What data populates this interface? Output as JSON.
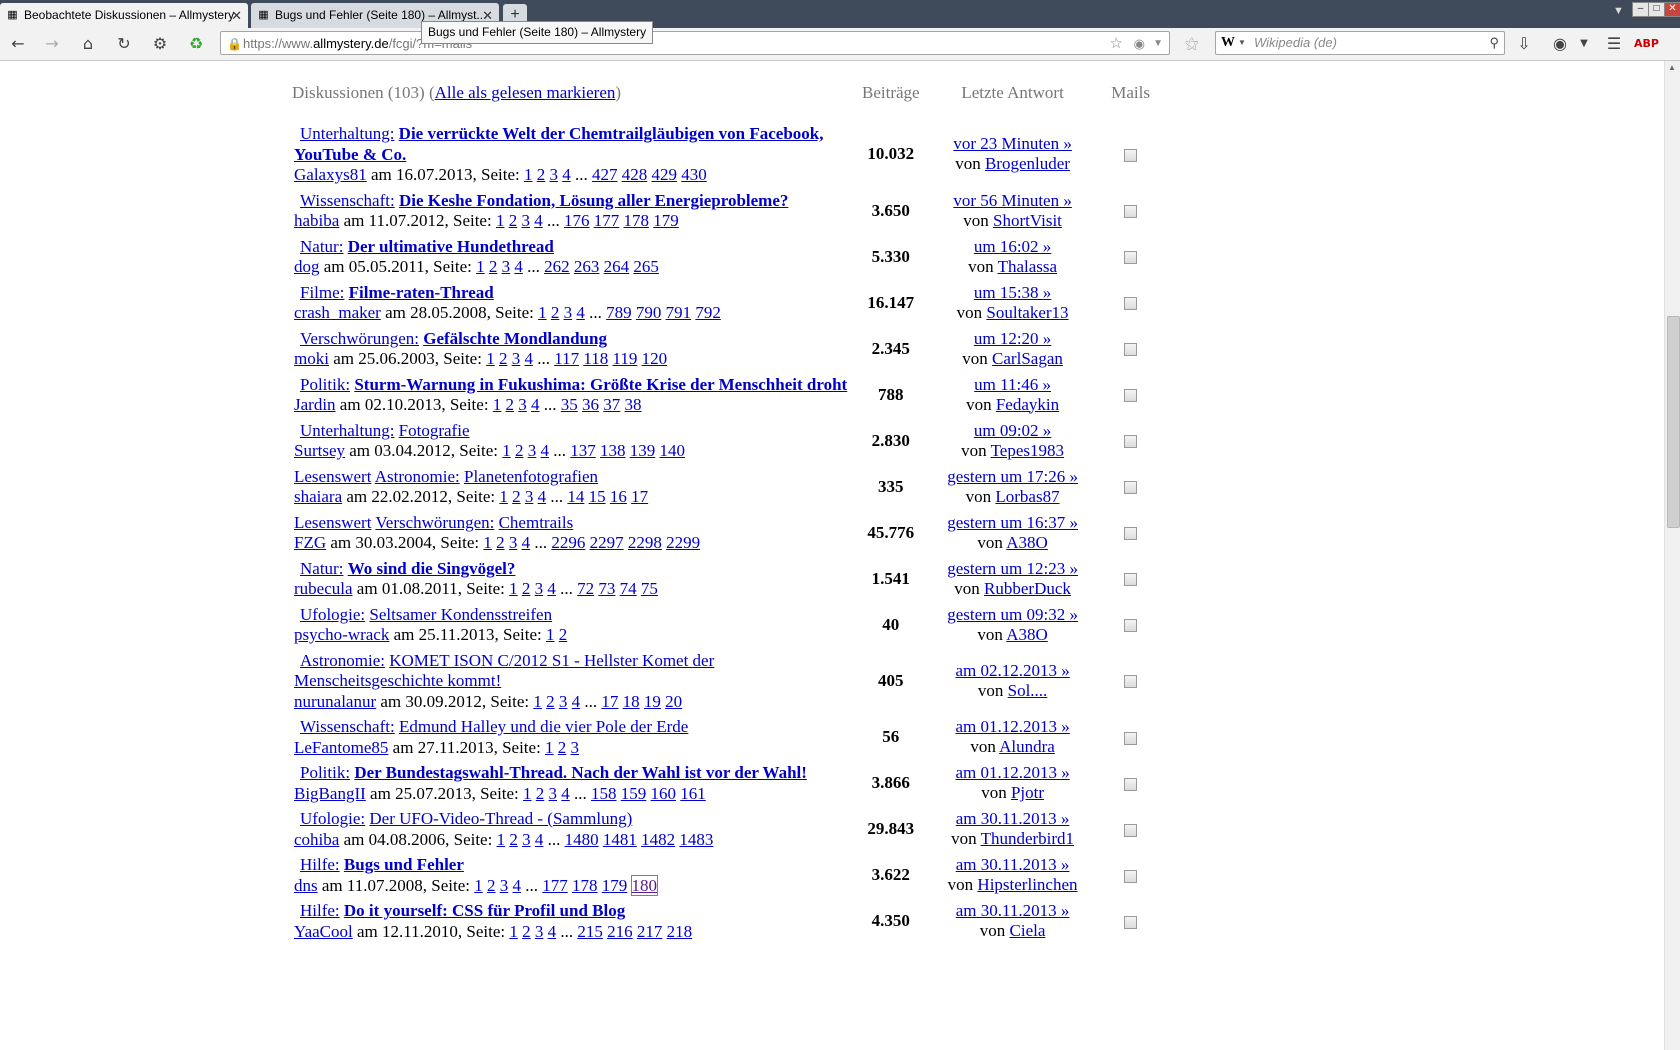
{
  "browser": {
    "tabs": [
      {
        "title": "Beobachtete Diskussionen – Allmystery",
        "active": true
      },
      {
        "title": "Bugs und Fehler (Seite 180) – Allmyst...",
        "active": false
      }
    ],
    "tooltip": "Bugs und Fehler (Seite 180) – Allmystery",
    "url_prefix": "https://www.",
    "url_domain": "allmystery.de",
    "url_path": "/fcgi/?m=mails",
    "search_placeholder": "Wikipedia (de)",
    "search_engine_label": "W",
    "icons": {
      "back": "arrow-left",
      "forward": "arrow-right",
      "home": "house",
      "reload": "circular-arrow",
      "addon1": "gears",
      "addon2": "green-refresh",
      "lock": "padlock",
      "bookmark": "star",
      "pocket": "pocket",
      "rss": "rss",
      "download": "arrow-down",
      "pocket_toolbar": "pocket",
      "menu": "hamburger",
      "adblock": "abp"
    }
  },
  "header": {
    "prefix": "Diskussionen (103) (",
    "mark_all": "Alle als gelesen markieren",
    "suffix": ")",
    "col_posts": "Beiträge",
    "col_last": "Letzte Antwort",
    "col_mails": "Mails"
  },
  "labels": {
    "on": "am",
    "pages": "Seite:",
    "by": "von",
    "ellipsis": "...",
    "lesenswert": "Lesenswert"
  },
  "threads": [
    {
      "lesenswert": false,
      "category": "Unterhaltung:",
      "title": "Die verrückte Welt der Chemtrailgläubigen von Facebook, YouTube & Co.",
      "bold": true,
      "author": "Galaxys81",
      "date": "16.07.2013",
      "pages": [
        "1",
        "2",
        "3",
        "4"
      ],
      "last_pages": [
        "427",
        "428",
        "429",
        "430"
      ],
      "posts": "10.032",
      "last_time": "vor 23 Minuten »",
      "last_user": "Brogenluder"
    },
    {
      "lesenswert": false,
      "category": "Wissenschaft:",
      "title": "Die Keshe Fondation, Lösung aller Energieprobleme?",
      "bold": true,
      "author": "habiba",
      "date": "11.07.2012",
      "pages": [
        "1",
        "2",
        "3",
        "4"
      ],
      "last_pages": [
        "176",
        "177",
        "178",
        "179"
      ],
      "posts": "3.650",
      "last_time": "vor 56 Minuten »",
      "last_user": "ShortVisit"
    },
    {
      "lesenswert": false,
      "category": "Natur:",
      "title": "Der ultimative Hundethread",
      "bold": true,
      "author": "dog",
      "date": "05.05.2011",
      "pages": [
        "1",
        "2",
        "3",
        "4"
      ],
      "last_pages": [
        "262",
        "263",
        "264",
        "265"
      ],
      "posts": "5.330",
      "last_time": "um 16:02 »",
      "last_user": "Thalassa"
    },
    {
      "lesenswert": false,
      "category": "Filme:",
      "title": "Filme-raten-Thread",
      "bold": true,
      "author": "crash_maker",
      "date": "28.05.2008",
      "pages": [
        "1",
        "2",
        "3",
        "4"
      ],
      "last_pages": [
        "789",
        "790",
        "791",
        "792"
      ],
      "posts": "16.147",
      "last_time": "um 15:38 »",
      "last_user": "Soultaker13"
    },
    {
      "lesenswert": false,
      "category": "Verschwörungen:",
      "title": "Gefälschte Mondlandung",
      "bold": true,
      "author": "moki",
      "date": "25.06.2003",
      "pages": [
        "1",
        "2",
        "3",
        "4"
      ],
      "last_pages": [
        "117",
        "118",
        "119",
        "120"
      ],
      "posts": "2.345",
      "last_time": "um 12:20 »",
      "last_user": "CarlSagan"
    },
    {
      "lesenswert": false,
      "category": "Politik:",
      "title": "Sturm-Warnung in Fukushima: Größte Krise der Menschheit droht",
      "bold": true,
      "author": "Jardin",
      "date": "02.10.2013",
      "pages": [
        "1",
        "2",
        "3",
        "4"
      ],
      "last_pages": [
        "35",
        "36",
        "37",
        "38"
      ],
      "posts": "788",
      "last_time": "um 11:46 »",
      "last_user": "Fedaykin"
    },
    {
      "lesenswert": false,
      "category": "Unterhaltung:",
      "title": "Fotografie",
      "bold": false,
      "author": "Surtsey",
      "date": "03.04.2012",
      "pages": [
        "1",
        "2",
        "3",
        "4"
      ],
      "last_pages": [
        "137",
        "138",
        "139",
        "140"
      ],
      "posts": "2.830",
      "last_time": "um 09:02 »",
      "last_user": "Tepes1983"
    },
    {
      "lesenswert": true,
      "category": "Astronomie:",
      "title": "Planetenfotografien",
      "bold": false,
      "author": "shaiara",
      "date": "22.02.2012",
      "pages": [
        "1",
        "2",
        "3",
        "4"
      ],
      "last_pages": [
        "14",
        "15",
        "16",
        "17"
      ],
      "posts": "335",
      "last_time": "gestern um 17:26 »",
      "last_user": "Lorbas87"
    },
    {
      "lesenswert": true,
      "category": "Verschwörungen:",
      "title": "Chemtrails",
      "bold": false,
      "author": "FZG",
      "date": "30.03.2004",
      "pages": [
        "1",
        "2",
        "3",
        "4"
      ],
      "last_pages": [
        "2296",
        "2297",
        "2298",
        "2299"
      ],
      "posts": "45.776",
      "last_time": "gestern um 16:37 »",
      "last_user": "A38O"
    },
    {
      "lesenswert": false,
      "category": "Natur:",
      "title": "Wo sind die Singvögel?",
      "bold": true,
      "author": "rubecula",
      "date": "01.08.2011",
      "pages": [
        "1",
        "2",
        "3",
        "4"
      ],
      "last_pages": [
        "72",
        "73",
        "74",
        "75"
      ],
      "posts": "1.541",
      "last_time": "gestern um 12:23 »",
      "last_user": "RubberDuck"
    },
    {
      "lesenswert": false,
      "category": "Ufologie:",
      "title": "Seltsamer Kondensstreifen",
      "bold": false,
      "author": "psycho-wrack",
      "date": "25.11.2013",
      "pages": [
        "1",
        "2"
      ],
      "last_pages": [],
      "posts": "40",
      "last_time": "gestern um 09:32 »",
      "last_user": "A38O"
    },
    {
      "lesenswert": false,
      "category": "Astronomie:",
      "title": "KOMET ISON C/2012 S1 - Hellster Komet der Menscheitsgeschichte kommt!",
      "bold": false,
      "author": "nurunalanur",
      "date": "30.09.2012",
      "pages": [
        "1",
        "2",
        "3",
        "4"
      ],
      "last_pages": [
        "17",
        "18",
        "19",
        "20"
      ],
      "posts": "405",
      "last_time": "am 02.12.2013 »",
      "last_user": "Sol...."
    },
    {
      "lesenswert": false,
      "category": "Wissenschaft:",
      "title": "Edmund Halley und die vier Pole der Erde",
      "bold": false,
      "author": "LeFantome85",
      "date": "27.11.2013",
      "pages": [
        "1",
        "2",
        "3"
      ],
      "last_pages": [],
      "posts": "56",
      "last_time": "am 01.12.2013 »",
      "last_user": "Alundra"
    },
    {
      "lesenswert": false,
      "category": "Politik:",
      "title": "Der Bundestagswahl-Thread. Nach der Wahl ist vor der Wahl!",
      "bold": true,
      "author": "BigBangII",
      "date": "25.07.2013",
      "pages": [
        "1",
        "2",
        "3",
        "4"
      ],
      "last_pages": [
        "158",
        "159",
        "160",
        "161"
      ],
      "posts": "3.866",
      "last_time": "am 01.12.2013 »",
      "last_user": "Pjotr"
    },
    {
      "lesenswert": false,
      "category": "Ufologie:",
      "title": "Der UFO-Video-Thread - (Sammlung)",
      "bold": false,
      "author": "cohiba",
      "date": "04.08.2006",
      "pages": [
        "1",
        "2",
        "3",
        "4"
      ],
      "last_pages": [
        "1480",
        "1481",
        "1482",
        "1483"
      ],
      "posts": "29.843",
      "last_time": "am 30.11.2013 »",
      "last_user": "Thunderbird1"
    },
    {
      "lesenswert": false,
      "category": "Hilfe:",
      "title": "Bugs und Fehler",
      "bold": true,
      "author": "dns",
      "date": "11.07.2008",
      "pages": [
        "1",
        "2",
        "3",
        "4"
      ],
      "last_pages": [
        "177",
        "178",
        "179",
        "180"
      ],
      "current_page": "180",
      "posts": "3.622",
      "last_time": "am 30.11.2013 »",
      "last_user": "Hipsterlinchen"
    },
    {
      "lesenswert": false,
      "category": "Hilfe:",
      "title": "Do it yourself: CSS für Profil und Blog",
      "bold": true,
      "author": "YaaCool",
      "date": "12.11.2010",
      "pages": [
        "1",
        "2",
        "3",
        "4"
      ],
      "last_pages": [
        "215",
        "216",
        "217",
        "218"
      ],
      "posts": "4.350",
      "last_time": "am 30.11.2013 »",
      "last_user": "Ciela"
    }
  ]
}
